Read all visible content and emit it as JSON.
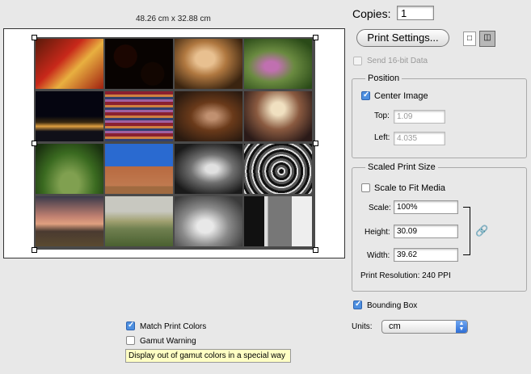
{
  "preview": {
    "dimensions": "48.26 cm x 32.88 cm"
  },
  "copies": {
    "label": "Copies:",
    "value": "1"
  },
  "print_settings": {
    "label": "Print Settings..."
  },
  "send16": {
    "label": "Send 16-bit Data",
    "checked": false,
    "enabled": false
  },
  "position": {
    "title": "Position",
    "center_image": {
      "label": "Center Image",
      "checked": true
    },
    "top": {
      "label": "Top:",
      "value": "1.09"
    },
    "left": {
      "label": "Left:",
      "value": "4.035"
    }
  },
  "scaled": {
    "title": "Scaled Print Size",
    "scale_to_fit": {
      "label": "Scale to Fit Media",
      "checked": false
    },
    "scale": {
      "label": "Scale:",
      "value": "100%"
    },
    "height": {
      "label": "Height:",
      "value": "30.09"
    },
    "width": {
      "label": "Width:",
      "value": "39.62"
    },
    "resolution": "Print Resolution: 240 PPI"
  },
  "bounding_box": {
    "label": "Bounding Box",
    "checked": true
  },
  "units": {
    "label": "Units:",
    "value": "cm"
  },
  "match_print_colors": {
    "label": "Match Print Colors",
    "checked": true
  },
  "gamut_warning": {
    "label": "Gamut Warning",
    "checked": false
  },
  "tooltip": "Display out of gamut colors in a special way",
  "thumbnails": [
    "chili-peppers",
    "painted-plates",
    "blonde-woman-portrait",
    "girl-in-garden",
    "city-night-lights",
    "striped-blankets",
    "woman-with-cello",
    "woman-silhouette",
    "garden-landscape",
    "adobe-church",
    "woman-profile-bw",
    "spiral-staircase-bw",
    "sunset-hills",
    "rolling-hills",
    "scooter-bw",
    "test-target-bw"
  ],
  "colors": {
    "accent": "#4d8fe0",
    "tooltip_bg": "#ffffc4",
    "sheet_bg": "#4a4a4a"
  }
}
